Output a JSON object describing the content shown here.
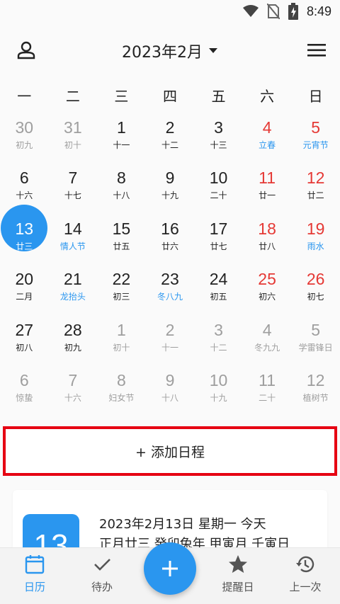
{
  "status": {
    "time": "8:49"
  },
  "header": {
    "title": "2023年2月"
  },
  "colors": {
    "accent": "#2a96ef",
    "weekend": "#e53935",
    "festival": "#2a96ef",
    "muted": "#9e9e9e",
    "normal": "#222222"
  },
  "weekdays": [
    "一",
    "二",
    "三",
    "四",
    "五",
    "六",
    "日"
  ],
  "weeks": [
    [
      {
        "num": "30",
        "sub": "初九",
        "numColor": "muted",
        "subColor": "muted"
      },
      {
        "num": "31",
        "sub": "初十",
        "numColor": "muted",
        "subColor": "muted"
      },
      {
        "num": "1",
        "sub": "十一",
        "numColor": "normal",
        "subColor": "normal"
      },
      {
        "num": "2",
        "sub": "十二",
        "numColor": "normal",
        "subColor": "normal"
      },
      {
        "num": "3",
        "sub": "十三",
        "numColor": "normal",
        "subColor": "normal"
      },
      {
        "num": "4",
        "sub": "立春",
        "numColor": "weekend",
        "subColor": "festival"
      },
      {
        "num": "5",
        "sub": "元宵节",
        "numColor": "weekend",
        "subColor": "festival"
      }
    ],
    [
      {
        "num": "6",
        "sub": "十六",
        "numColor": "normal",
        "subColor": "normal"
      },
      {
        "num": "7",
        "sub": "十七",
        "numColor": "normal",
        "subColor": "normal"
      },
      {
        "num": "8",
        "sub": "十八",
        "numColor": "normal",
        "subColor": "normal"
      },
      {
        "num": "9",
        "sub": "十九",
        "numColor": "normal",
        "subColor": "normal"
      },
      {
        "num": "10",
        "sub": "二十",
        "numColor": "normal",
        "subColor": "normal"
      },
      {
        "num": "11",
        "sub": "廿一",
        "numColor": "weekend",
        "subColor": "normal"
      },
      {
        "num": "12",
        "sub": "廿二",
        "numColor": "weekend",
        "subColor": "normal"
      }
    ],
    [
      {
        "num": "13",
        "sub": "廿三",
        "numColor": "white",
        "subColor": "white",
        "today": true
      },
      {
        "num": "14",
        "sub": "情人节",
        "numColor": "normal",
        "subColor": "festival"
      },
      {
        "num": "15",
        "sub": "廿五",
        "numColor": "normal",
        "subColor": "normal"
      },
      {
        "num": "16",
        "sub": "廿六",
        "numColor": "normal",
        "subColor": "normal"
      },
      {
        "num": "17",
        "sub": "廿七",
        "numColor": "normal",
        "subColor": "normal"
      },
      {
        "num": "18",
        "sub": "廿八",
        "numColor": "weekend",
        "subColor": "normal"
      },
      {
        "num": "19",
        "sub": "雨水",
        "numColor": "weekend",
        "subColor": "festival"
      }
    ],
    [
      {
        "num": "20",
        "sub": "二月",
        "numColor": "normal",
        "subColor": "normal"
      },
      {
        "num": "21",
        "sub": "龙抬头",
        "numColor": "normal",
        "subColor": "festival"
      },
      {
        "num": "22",
        "sub": "初三",
        "numColor": "normal",
        "subColor": "normal"
      },
      {
        "num": "23",
        "sub": "冬八九",
        "numColor": "normal",
        "subColor": "festival"
      },
      {
        "num": "24",
        "sub": "初五",
        "numColor": "normal",
        "subColor": "normal"
      },
      {
        "num": "25",
        "sub": "初六",
        "numColor": "weekend",
        "subColor": "normal"
      },
      {
        "num": "26",
        "sub": "初七",
        "numColor": "weekend",
        "subColor": "normal"
      }
    ],
    [
      {
        "num": "27",
        "sub": "初八",
        "numColor": "normal",
        "subColor": "normal"
      },
      {
        "num": "28",
        "sub": "初九",
        "numColor": "normal",
        "subColor": "normal"
      },
      {
        "num": "1",
        "sub": "初十",
        "numColor": "muted",
        "subColor": "muted"
      },
      {
        "num": "2",
        "sub": "十一",
        "numColor": "muted",
        "subColor": "muted"
      },
      {
        "num": "3",
        "sub": "十二",
        "numColor": "muted",
        "subColor": "muted"
      },
      {
        "num": "4",
        "sub": "冬九九",
        "numColor": "muted",
        "subColor": "muted"
      },
      {
        "num": "5",
        "sub": "学雷锋日",
        "numColor": "muted",
        "subColor": "muted"
      }
    ],
    [
      {
        "num": "6",
        "sub": "惊蛰",
        "numColor": "muted",
        "subColor": "muted"
      },
      {
        "num": "7",
        "sub": "十六",
        "numColor": "muted",
        "subColor": "muted"
      },
      {
        "num": "8",
        "sub": "妇女节",
        "numColor": "muted",
        "subColor": "muted"
      },
      {
        "num": "9",
        "sub": "十八",
        "numColor": "muted",
        "subColor": "muted"
      },
      {
        "num": "10",
        "sub": "十九",
        "numColor": "muted",
        "subColor": "muted"
      },
      {
        "num": "11",
        "sub": "二十",
        "numColor": "muted",
        "subColor": "muted"
      },
      {
        "num": "12",
        "sub": "植树节",
        "numColor": "muted",
        "subColor": "muted"
      }
    ]
  ],
  "add_schedule": {
    "label": "+ 添加日程"
  },
  "detail": {
    "big_date": "13",
    "line1": "2023年2月13日 星期一 今天",
    "line2": "正月廿三 癸卯兔年 甲寅月 壬寅日"
  },
  "nav": [
    {
      "label": "日历",
      "icon": "calendar-icon",
      "active": true
    },
    {
      "label": "待办",
      "icon": "check-icon",
      "active": false
    },
    {
      "label": "提醒日",
      "icon": "star-icon",
      "active": false
    },
    {
      "label": "上一次",
      "icon": "history-icon",
      "active": false
    }
  ],
  "fab": {
    "icon": "plus-icon"
  }
}
